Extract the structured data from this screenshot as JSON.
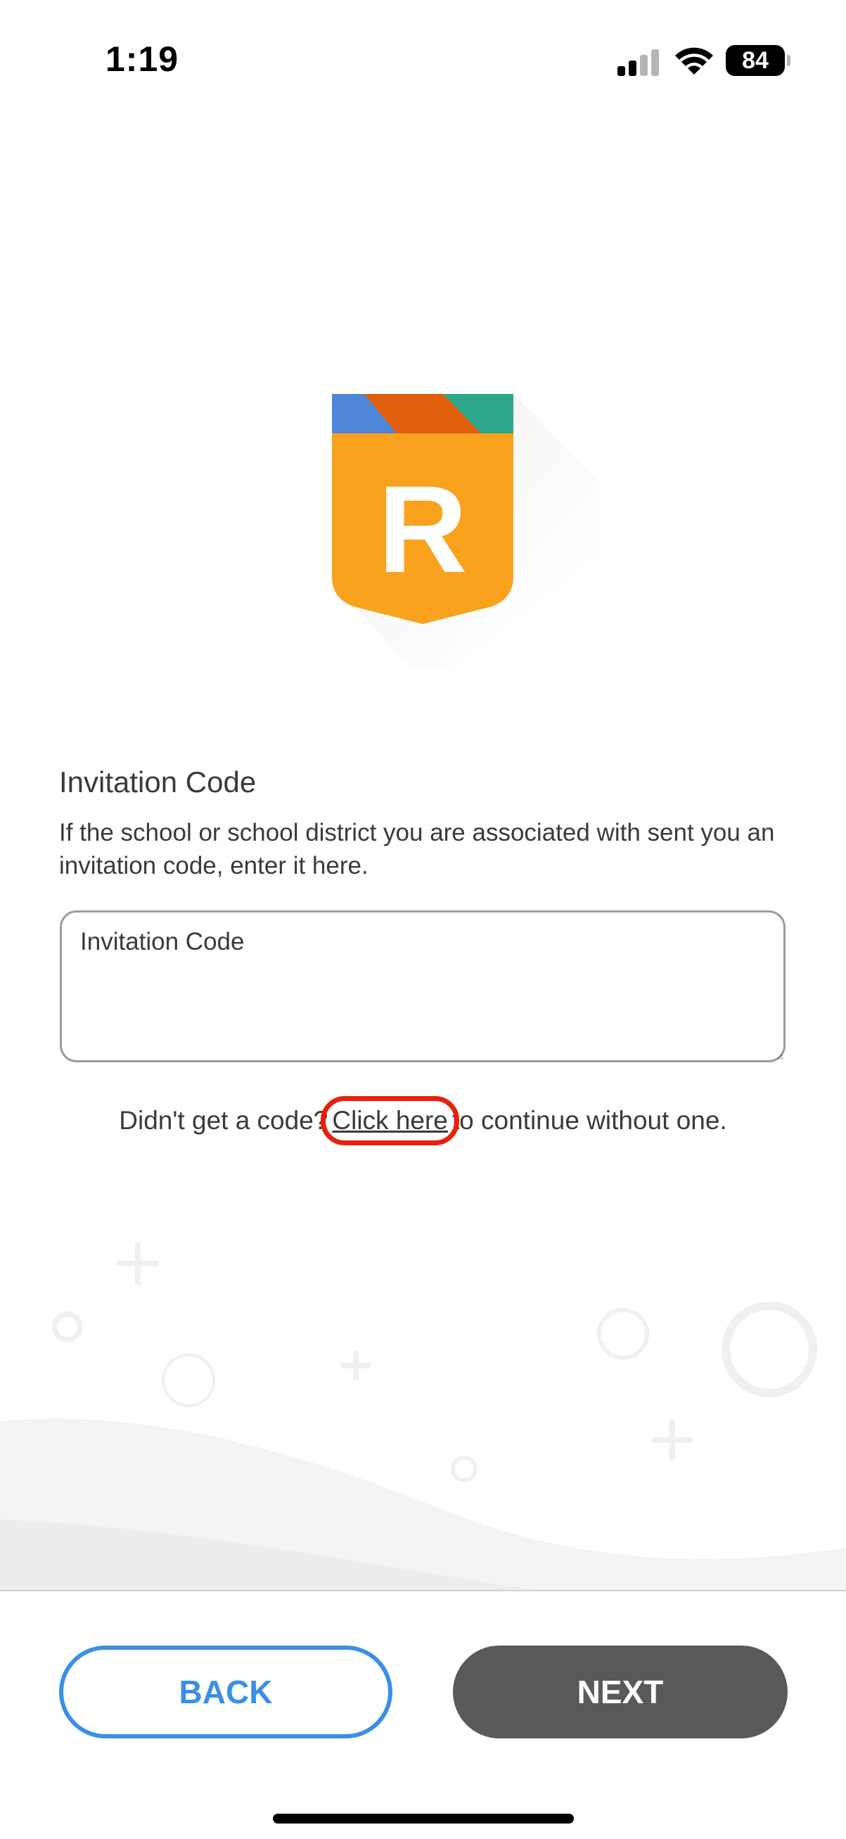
{
  "status_bar": {
    "time": "1:19",
    "battery_level": "84",
    "signal_icon": "cellular-signal-icon",
    "wifi_icon": "wifi-icon",
    "battery_icon": "battery-icon"
  },
  "logo": {
    "letter": "R",
    "icon": "app-logo-shield-icon",
    "colors": {
      "blue": "#4f86d8",
      "orange_dark": "#e05e0c",
      "teal": "#2ea68c",
      "shield": "#f9a21e"
    }
  },
  "invitation": {
    "title": "Invitation Code",
    "description": "If the school or school district you are associated with sent you an invitation code, enter it here.",
    "input_placeholder": "Invitation Code",
    "input_value": ""
  },
  "no_code": {
    "prefix": "Didn't get a code?",
    "link_text": "Click here",
    "suffix": "to continue without one."
  },
  "buttons": {
    "back_label": "BACK",
    "next_label": "NEXT"
  },
  "colors": {
    "accent_blue": "#3a8fe8",
    "next_gray": "#595959",
    "highlight_red": "#e8200b",
    "text": "#3a3a3a"
  }
}
